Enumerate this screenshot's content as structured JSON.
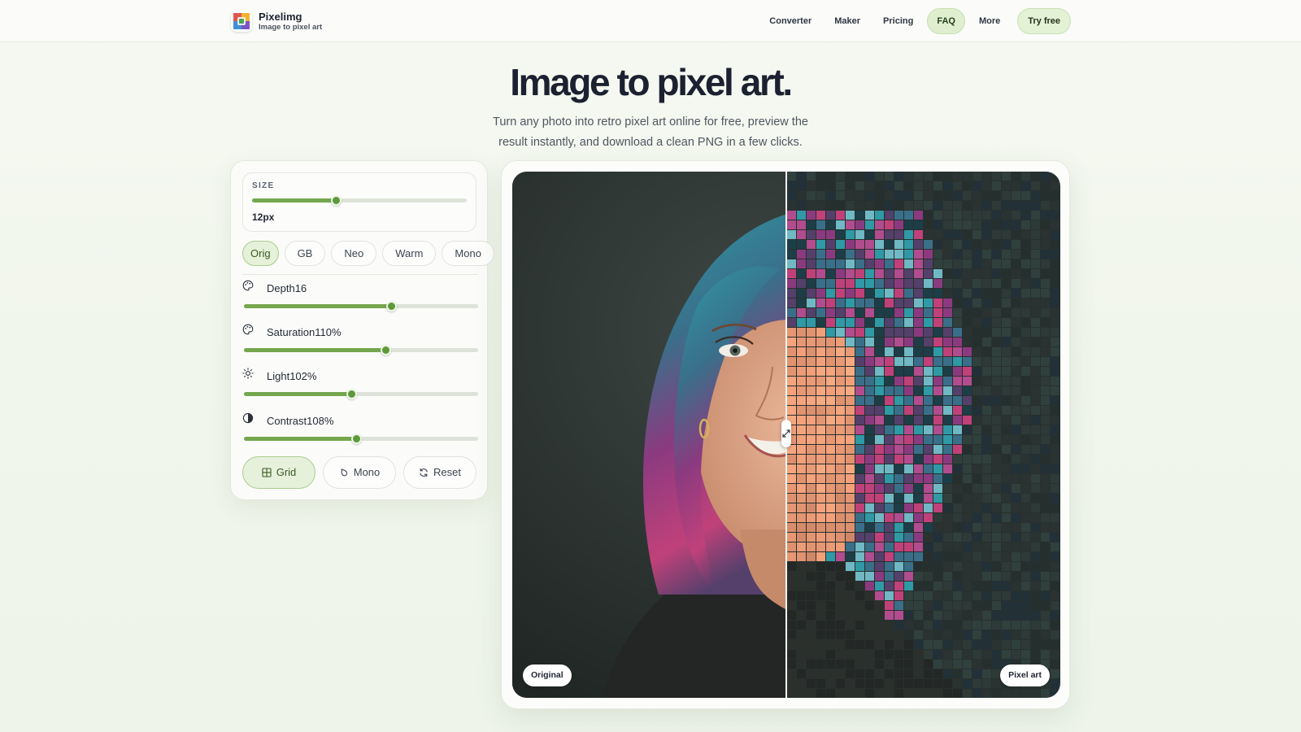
{
  "header": {
    "brand_name": "Pixelimg",
    "brand_tagline": "Image to pixel art",
    "nav": [
      {
        "label": "Converter",
        "active": false
      },
      {
        "label": "Maker",
        "active": false
      },
      {
        "label": "Pricing",
        "active": false
      },
      {
        "label": "FAQ",
        "active": true
      },
      {
        "label": "More",
        "active": false
      }
    ],
    "cta_label": "Try free"
  },
  "hero": {
    "title": "Image to pixel art.",
    "subtitle": "Turn any photo into retro pixel art online for free, preview the result instantly, and download a clean PNG in a few clicks."
  },
  "controls": {
    "size": {
      "label": "SIZE",
      "value_text": "12px",
      "fill_fraction": 0.39
    },
    "presets": [
      {
        "label": "Orig",
        "active": true
      },
      {
        "label": "GB",
        "active": false
      },
      {
        "label": "Neo",
        "active": false
      },
      {
        "label": "Warm",
        "active": false
      },
      {
        "label": "Mono",
        "active": false
      }
    ],
    "sliders": [
      {
        "name": "Depth",
        "value": "16",
        "icon": "palette-icon",
        "fill_fraction": 0.63
      },
      {
        "name": "Saturation",
        "value": "110%",
        "icon": "palette-icon",
        "fill_fraction": 0.605
      },
      {
        "name": "Light",
        "value": "102%",
        "icon": "sun-icon",
        "fill_fraction": 0.46
      },
      {
        "name": "Contrast",
        "value": "108%",
        "icon": "contrast-icon",
        "fill_fraction": 0.48
      }
    ],
    "actions": [
      {
        "label": "Grid",
        "icon": "grid-icon",
        "active": true
      },
      {
        "label": "Mono",
        "icon": "droplet-icon",
        "active": false
      },
      {
        "label": "Reset",
        "icon": "refresh-icon",
        "active": false
      }
    ]
  },
  "preview": {
    "left_label": "Original",
    "right_label": "Pixel art",
    "split_fraction": 0.5
  },
  "colors": {
    "accent": "#75a74e",
    "accent_knob": "#5d9939",
    "active_chip_bg": "#e5f1d9",
    "photo_background": "#28302e"
  }
}
